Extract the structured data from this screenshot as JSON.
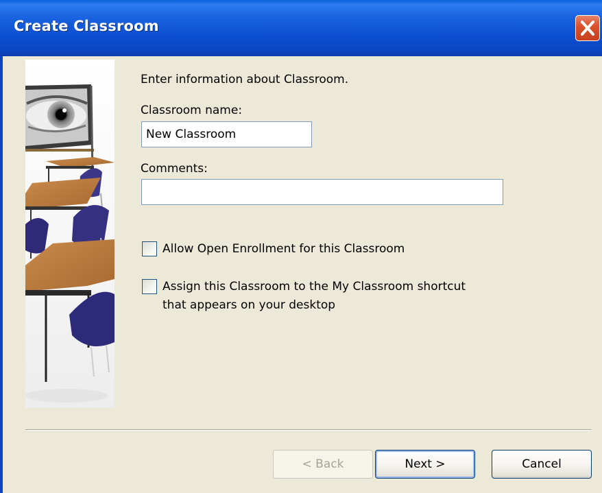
{
  "window": {
    "title": "Create Classroom",
    "close_icon": "close-icon"
  },
  "main": {
    "intro_text": "Enter information about Classroom.",
    "classroom_name_label": "Classroom name:",
    "classroom_name_value": "New Classroom",
    "comments_label": "Comments:",
    "comments_value": "",
    "open_enrollment_label": "Allow Open Enrollment for this Classroom",
    "open_enrollment_checked": false,
    "assign_shortcut_label_line1": "Assign this Classroom to the My Classroom shortcut",
    "assign_shortcut_label_line2": "that appears on your desktop",
    "assign_shortcut_checked": false
  },
  "buttons": {
    "back_label": "< Back",
    "next_label": "Next >",
    "cancel_label": "Cancel"
  },
  "colors": {
    "titlebar": "#0a46c4",
    "dialog_background": "#ece9d8",
    "close_button": "#d9532c",
    "input_border": "#7f9db9",
    "button_border": "#003c74"
  }
}
